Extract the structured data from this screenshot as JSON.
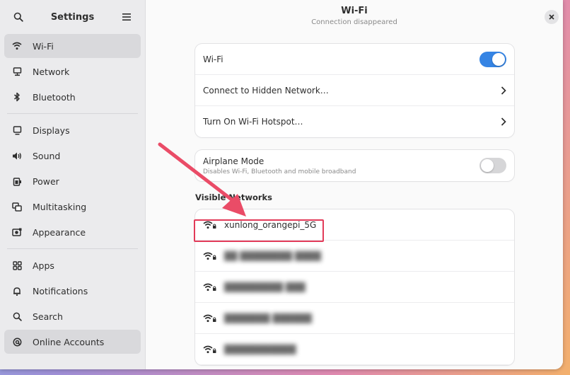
{
  "sidebar": {
    "title": "Settings",
    "items": [
      {
        "label": "Wi-Fi",
        "icon": "wifi-icon",
        "active": true
      },
      {
        "label": "Network",
        "icon": "network-icon"
      },
      {
        "label": "Bluetooth",
        "icon": "bluetooth-icon"
      },
      {
        "label": "Displays",
        "icon": "display-icon"
      },
      {
        "label": "Sound",
        "icon": "sound-icon"
      },
      {
        "label": "Power",
        "icon": "power-icon"
      },
      {
        "label": "Multitasking",
        "icon": "multitasking-icon"
      },
      {
        "label": "Appearance",
        "icon": "appearance-icon"
      },
      {
        "label": "Apps",
        "icon": "apps-icon"
      },
      {
        "label": "Notifications",
        "icon": "bell-icon"
      },
      {
        "label": "Search",
        "icon": "search-icon"
      },
      {
        "label": "Online Accounts",
        "icon": "at-icon",
        "active": true
      }
    ]
  },
  "header": {
    "title": "Wi-Fi",
    "subtitle": "Connection disappeared"
  },
  "wifi_card": {
    "wifi_label": "Wi-Fi",
    "wifi_enabled": true,
    "hidden_network_label": "Connect to Hidden Network…",
    "hotspot_label": "Turn On Wi-Fi Hotspot…"
  },
  "airplane": {
    "label": "Airplane Mode",
    "description": "Disables Wi-Fi, Bluetooth and mobile broadband",
    "enabled": false
  },
  "visible_networks": {
    "label": "Visible Networks",
    "networks": [
      {
        "ssid": "xunlong_orangepi_5G",
        "secured": true,
        "highlighted": true
      },
      {
        "ssid": "██ ████████ ████",
        "secured": true,
        "blurred": true
      },
      {
        "ssid": "█████████ ███",
        "secured": true,
        "blurred": true
      },
      {
        "ssid": "███████ ██████",
        "secured": true,
        "blurred": true
      },
      {
        "ssid": "███████████",
        "secured": true,
        "blurred": true
      }
    ]
  },
  "colors": {
    "accent": "#3584e4",
    "annotation": "#e23b59"
  }
}
